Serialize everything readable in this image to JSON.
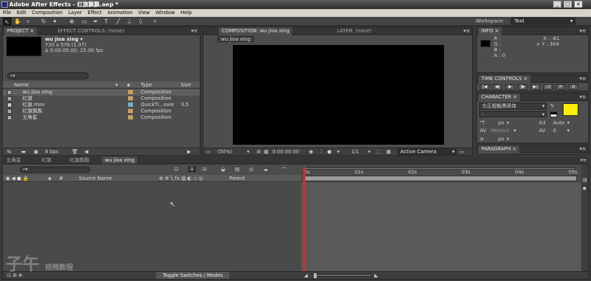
{
  "app": {
    "title": "Adobe After Effects - 红旗飘飘.aep *"
  },
  "menu": [
    "File",
    "Edit",
    "Composition",
    "Layer",
    "Effect",
    "Animation",
    "View",
    "Window",
    "Help"
  ],
  "workspace": {
    "label": "Workspace:",
    "value": "Text"
  },
  "project_panel": {
    "tab_project": "PROJECT ×",
    "tab_effects": "EFFECT CONTROLS: (none)",
    "selected_name": "wu jioa xing ▾",
    "selected_dims": "720 x 576 (1.07)",
    "selected_dur": "Δ 0:00:05:00, 25.00 fps",
    "search_placeholder": "",
    "columns": {
      "name": "Name",
      "type": "Type",
      "size": "Size"
    },
    "items": [
      {
        "name": "wu jioa xing",
        "type": "Composition",
        "size": "",
        "color": "#c8a060"
      },
      {
        "name": "红旗",
        "type": "Composition",
        "size": "",
        "color": "#c8a060"
      },
      {
        "name": "红旗.mov",
        "type": "QuickTi...ovie",
        "size": "3.5",
        "color": "#7ab0c8"
      },
      {
        "name": "红旗飘飘",
        "type": "Composition",
        "size": "",
        "color": "#c8a060"
      },
      {
        "name": "五角星",
        "type": "Composition",
        "size": "",
        "color": "#c8a060"
      }
    ],
    "bpc": "8 bpc"
  },
  "comp_panel": {
    "tab": "COMPOSITION: wu jioa xing",
    "layer_tab": "LAYER: (none)",
    "subtab": "wu jioa xing",
    "zoom": "(50%)",
    "timecode": "0:00:00:00",
    "resolution": "1/1",
    "view": "Active Camera"
  },
  "info_panel": {
    "tab": "INFO ×",
    "r": "R :",
    "g": "G :",
    "b": "B :",
    "a": "A : 0",
    "x": "X : -81",
    "y": "+ Y : 304"
  },
  "time_controls": {
    "tab": "TIME CONTROLS ×",
    "buttons": [
      "|◀",
      "◀|",
      "▶",
      "|▶",
      "▶|",
      "◁)",
      "⟳",
      "⊟"
    ]
  },
  "character": {
    "tab": "CHARACTER ×",
    "font": "方正超粗黑简体",
    "style": "-",
    "size_unit": "px",
    "leading": "Auto",
    "kerning": "Metrics",
    "tracking": "0",
    "stroke_unit": "px",
    "fill_color": "#ffee00"
  },
  "paragraph": {
    "tab": "PARAGRAPH ×"
  },
  "timeline": {
    "tabs": [
      "五角星",
      "红旗",
      "红旗飘飘",
      "wu jioa xing"
    ],
    "source_name_col": "Source Name",
    "parent_col": "Parent",
    "ruler": [
      "0s",
      "01s",
      "02s",
      "03s",
      "04s",
      "05s"
    ],
    "toggle": "Toggle Switches / Modes"
  },
  "watermark": {
    "text1": "子午",
    "text2": "视频教程"
  }
}
